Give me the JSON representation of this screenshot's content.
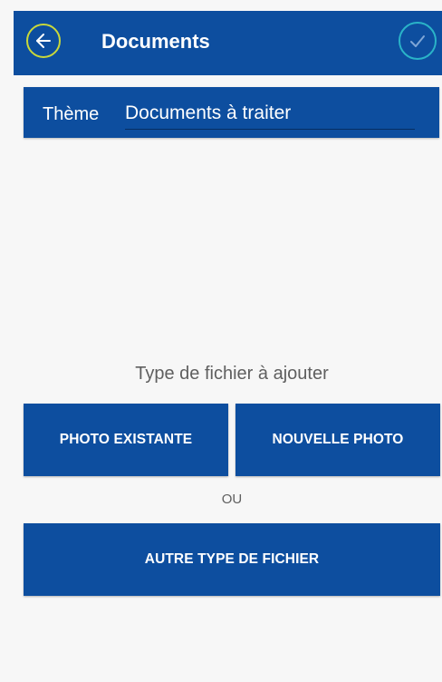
{
  "app_bar": {
    "title": "Documents",
    "back_icon": "arrow-left-circle-icon",
    "confirm_icon": "check-circle-icon",
    "colors": {
      "bar": "#0d4e9f",
      "back_ring": "#c9d83a",
      "confirm_ring": "#2ab3c8"
    }
  },
  "theme": {
    "label": "Thème",
    "value": "Documents à traiter"
  },
  "file_type": {
    "prompt": "Type de fichier à ajouter",
    "existing_photo_label": "PHOTO EXISTANTE",
    "new_photo_label": "NOUVELLE PHOTO",
    "or_label": "OU",
    "other_file_label": "AUTRE TYPE DE FICHIER"
  }
}
